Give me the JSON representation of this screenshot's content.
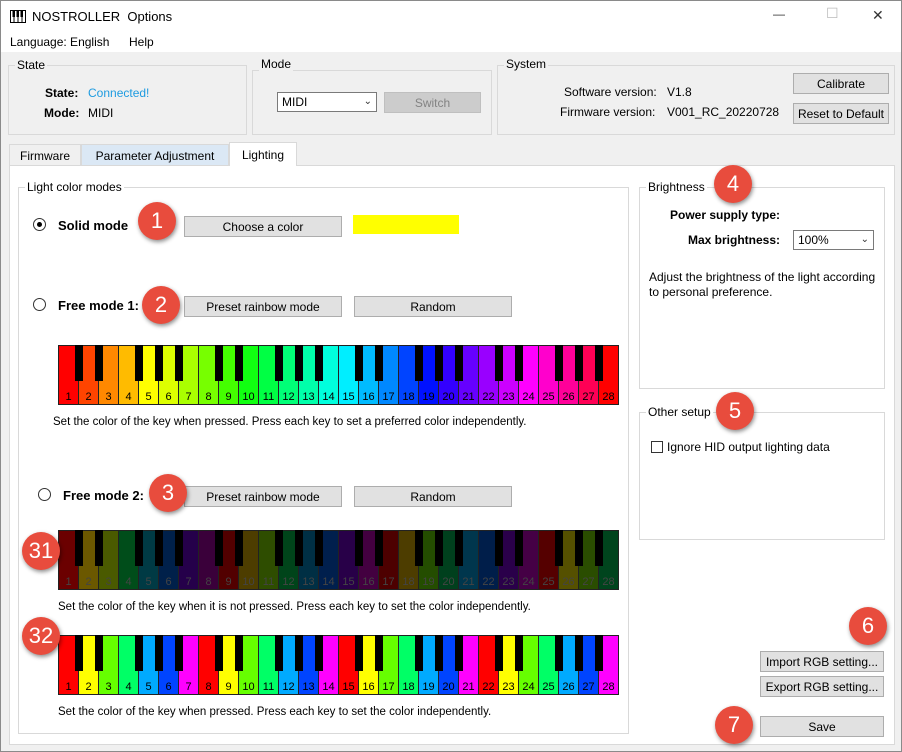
{
  "window": {
    "title": "NOSTROLLER  Options",
    "minimize_glyph": "—",
    "maximize_glyph": "☐",
    "close_glyph": "✕"
  },
  "menu": {
    "language": "Language: English",
    "help": "Help"
  },
  "state": {
    "group_label": "State",
    "state_label": "State:",
    "state_value": "Connected!",
    "state_color": "#1e9be0",
    "mode_label": "Mode:",
    "mode_value": "MIDI"
  },
  "mode": {
    "group_label": "Mode",
    "selected": "MIDI",
    "switch_label": "Switch"
  },
  "system": {
    "group_label": "System",
    "software_label": "Software version:",
    "software_value": "V1.8",
    "firmware_label": "Firmware version:",
    "firmware_value": "V001_RC_20220728",
    "calibrate_label": "Calibrate",
    "reset_label": "Reset to Default"
  },
  "tabs": [
    {
      "label": "Firmware"
    },
    {
      "label": "Parameter Adjustment"
    },
    {
      "label": "Lighting"
    }
  ],
  "light": {
    "group_label": "Light color modes",
    "solid_label": "Solid mode",
    "choose_color_label": "Choose a color",
    "solid_color": "#ffff00",
    "free1_label": "Free mode 1:",
    "free1_preset_label": "Preset rainbow mode",
    "free1_random_label": "Random",
    "free1_desc": "Set the color of the key when pressed. Press each key to set a preferred color independently.",
    "free2_label": "Free mode 2:",
    "free2_preset_label": "Preset rainbow mode",
    "free2_random_label": "Random",
    "free2_desc_not_pressed": "Set the color of the key when it is not pressed. Press each key to set the color independently.",
    "free2_desc_pressed": "Set the color of the key when pressed. Press each key to set the color independently."
  },
  "keyboards": {
    "labels": [
      "1",
      "2",
      "3",
      "4",
      "5",
      "6",
      "7",
      "8",
      "9",
      "10",
      "11",
      "12",
      "13",
      "14",
      "15",
      "16",
      "17",
      "18",
      "19",
      "20",
      "21",
      "22",
      "23",
      "24",
      "25",
      "26",
      "27",
      "28"
    ],
    "free1_colors": [
      "#ff0000",
      "#ff4400",
      "#ff8800",
      "#ffbb00",
      "#ffff00",
      "#ddff00",
      "#aaff00",
      "#77ff00",
      "#44ff00",
      "#11ff11",
      "#00ff44",
      "#00ff77",
      "#00ffaa",
      "#00ffdd",
      "#00eeff",
      "#00bbff",
      "#0088ff",
      "#0044ff",
      "#0011ff",
      "#3300ff",
      "#6600ff",
      "#9900ff",
      "#cc00ff",
      "#ff00ff",
      "#ff00cc",
      "#ff0099",
      "#ff0055",
      "#ff0000"
    ],
    "free2_dim_colors": [
      "#6b0000",
      "#6b5800",
      "#4a5a00",
      "#004d1a",
      "#003a44",
      "#00204a",
      "#25004a",
      "#3a003a",
      "#520000",
      "#4d3d00",
      "#2e4d00",
      "#00441a",
      "#002f44",
      "#001f4d",
      "#280048",
      "#430040",
      "#4d0000",
      "#4d3d00",
      "#244d00",
      "#00401d",
      "#00364d",
      "#001e4a",
      "#2a004a",
      "#450045",
      "#550000",
      "#555000",
      "#2a4d00",
      "#00441d"
    ],
    "free2_pressed_colors": [
      "#ff0000",
      "#ffff00",
      "#66ff00",
      "#00ff66",
      "#00aaff",
      "#0044ff",
      "#ff00ff",
      "#ff0000",
      "#ffff00",
      "#66ff00",
      "#00ff66",
      "#00aaff",
      "#0044ff",
      "#ff00ff",
      "#ff0000",
      "#ffff00",
      "#66ff00",
      "#00ff66",
      "#00aaff",
      "#0044ff",
      "#ff00ff",
      "#ff0000",
      "#ffff00",
      "#66ff00",
      "#00ff66",
      "#00aaff",
      "#0044ff",
      "#ff00ff"
    ]
  },
  "brightness": {
    "group_label": "Brightness",
    "power_label": "Power supply type:",
    "max_label": "Max brightness:",
    "max_value": "100%",
    "desc": "Adjust the brightness of the light according to personal preference."
  },
  "other": {
    "group_label": "Other setup",
    "ignore_hid_label": "Ignore HID output lighting data"
  },
  "actions": {
    "import_label": "Import RGB setting...",
    "export_label": "Export RGB setting...",
    "save_label": "Save"
  },
  "badges": [
    "1",
    "2",
    "3",
    "4",
    "5",
    "6",
    "7",
    "31",
    "32"
  ]
}
